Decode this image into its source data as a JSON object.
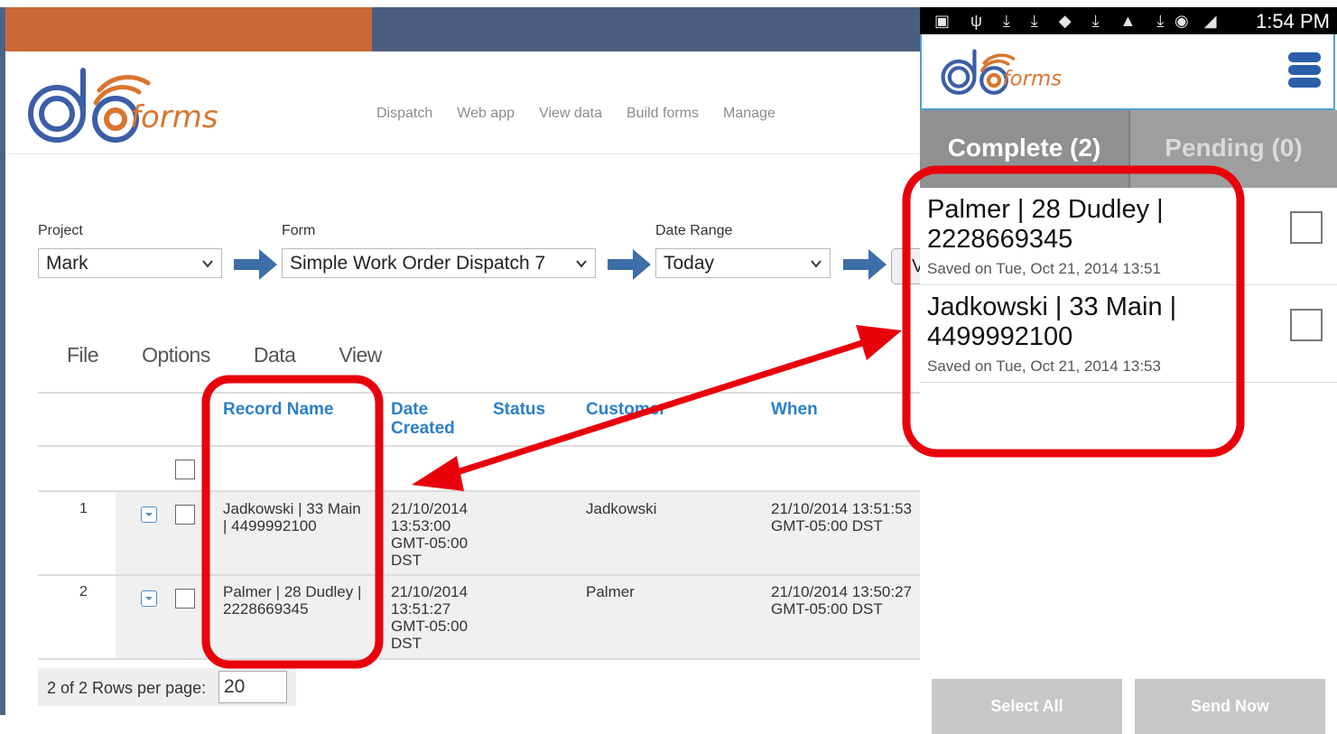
{
  "web": {
    "logo_text": "forms",
    "nav": [
      "Dispatch",
      "Web app",
      "View data",
      "Build forms",
      "Manage"
    ],
    "filters": {
      "project": {
        "label": "Project",
        "value": "Mark"
      },
      "form": {
        "label": "Form",
        "value": "Simple Work Order Dispatch 7"
      },
      "date_range": {
        "label": "Date Range",
        "value": "Today"
      },
      "edge_button_glyph": "V"
    },
    "menu": [
      "File",
      "Options",
      "Data",
      "View"
    ],
    "columns": {
      "record_name": "Record Name",
      "date_created_line1": "Date",
      "date_created_line2": "Created",
      "status": "Status",
      "customer": "Customer",
      "when": "When"
    },
    "rows": [
      {
        "num": "1",
        "name_line1": "Jadkowski | 33 Main",
        "name_line2": "| 4499992100",
        "created": [
          "21/10/2014",
          "13:53:00",
          "GMT-05:00",
          "DST"
        ],
        "customer": "Jadkowski",
        "when": [
          "21/10/2014 13:51:53",
          "GMT-05:00 DST"
        ]
      },
      {
        "num": "2",
        "name_line1": "Palmer | 28 Dudley |",
        "name_line2": "2228669345",
        "created": [
          "21/10/2014",
          "13:51:27",
          "GMT-05:00",
          "DST"
        ],
        "customer": "Palmer",
        "when": [
          "21/10/2014 13:50:27",
          "GMT-05:00 DST"
        ]
      }
    ],
    "pager": {
      "label": "2 of 2 Rows per page:",
      "rows_per_page": "20"
    }
  },
  "phone": {
    "status_icons": "▣ ψ ⤓ ⤓ ◆ ⤓ ▲ ⤓",
    "signal_icons": "◉ ◢",
    "time": "1:54 PM",
    "logo_text": "forms",
    "tabs": {
      "complete": "Complete (2)",
      "pending": "Pending (0)"
    },
    "items": [
      {
        "title_line1": "Palmer | 28 Dudley |",
        "title_line2": "2228669345",
        "saved": "Saved on Tue, Oct 21, 2014 13:51"
      },
      {
        "title_line1": "Jadkowski | 33 Main |",
        "title_line2": "4499992100",
        "saved": "Saved on Tue, Oct 21, 2014 13:53"
      }
    ],
    "buttons": {
      "select_all": "Select All",
      "send_now": "Send Now"
    }
  },
  "colors": {
    "accent_blue": "#2c7fc9",
    "header_orange": "#c96a34",
    "header_navy": "#4a5f7e",
    "highlight_red": "#e8000b",
    "tab_gray": "#909090"
  }
}
